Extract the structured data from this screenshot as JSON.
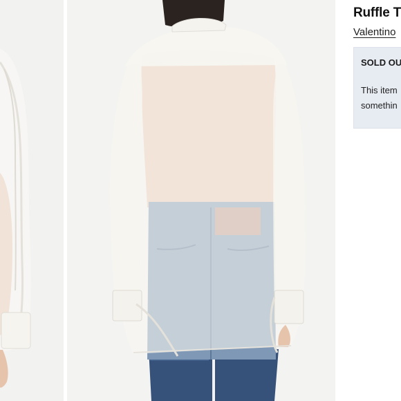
{
  "listing": {
    "title": "Ruffle T",
    "brand": "Valentino"
  },
  "status_box": {
    "heading": "SOLD OU",
    "line1": "This item",
    "line2": "somethin"
  },
  "colors": {
    "background": "#ffffff",
    "status_box": "#e7ebf2",
    "text": "#111111",
    "denim": "#6d87a6",
    "blouse": "#f4f1ea"
  },
  "images": {
    "main_alt": "back view of sheer white blouse over blue jeans",
    "thumb_alt": "side view of sheer white ruffle blouse"
  }
}
